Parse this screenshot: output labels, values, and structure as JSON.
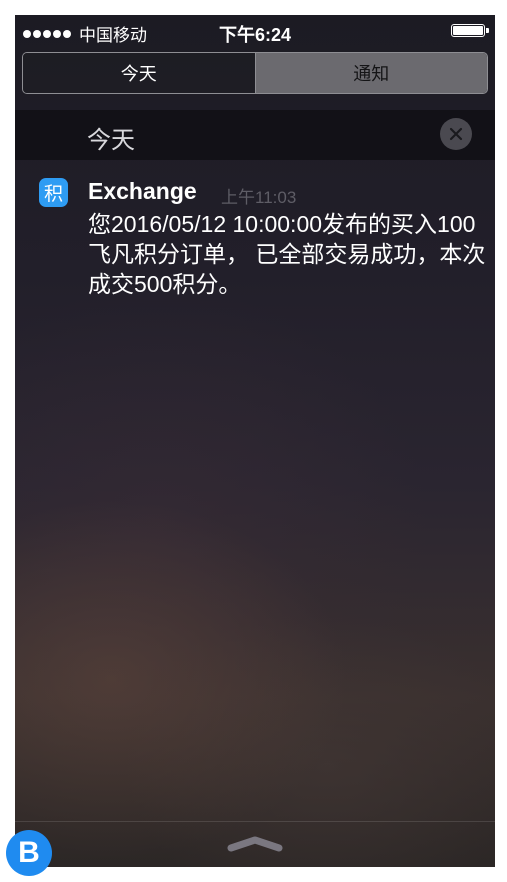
{
  "status_bar": {
    "carrier": "中国移动",
    "time": "下午6:24"
  },
  "tabs": [
    {
      "label": "今天",
      "selected": false
    },
    {
      "label": "通知",
      "selected": true
    }
  ],
  "section": {
    "title": "今天",
    "clear_icon": "close-icon"
  },
  "notification": {
    "app_icon_glyph": "积",
    "app_name": "Exchange",
    "time": "上午11:03",
    "body": "您2016/05/12 10:00:00发布的买入100飞凡积分订单， 已全部交易成功，本次成交500积分。"
  },
  "corner_badge": {
    "label": "B"
  },
  "colors": {
    "accent": "#2e9cf3",
    "badge": "#1f8bf0"
  }
}
